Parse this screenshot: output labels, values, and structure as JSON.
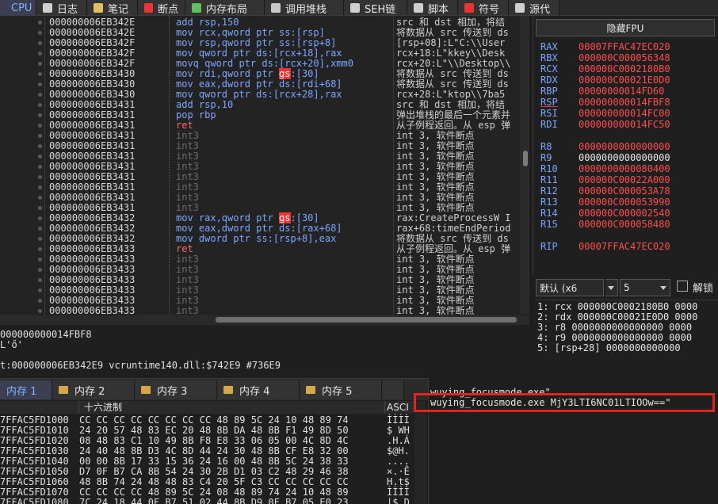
{
  "tabs": [
    {
      "label": "CPU",
      "icon": "cpu-icon",
      "color": "#5b9bff"
    },
    {
      "label": "日志",
      "icon": "log-icon",
      "color": "#cfcfcf"
    },
    {
      "label": "笔记",
      "icon": "notes-icon",
      "color": "#e0c060"
    },
    {
      "label": "断点",
      "icon": "breakpoint-icon",
      "color": "#e33"
    },
    {
      "label": "内存布局",
      "icon": "memory-map-icon",
      "color": "#5fbf5f"
    },
    {
      "label": "调用堆栈",
      "icon": "call-stack-icon",
      "color": "#c8c8c8"
    },
    {
      "label": "SEH链",
      "icon": "seh-icon",
      "color": "#cfcfcf"
    },
    {
      "label": "脚本",
      "icon": "script-icon",
      "color": "#cfcfcf"
    },
    {
      "label": "符号",
      "icon": "symbols-icon",
      "color": "#e33"
    },
    {
      "label": "源代",
      "icon": "source-icon",
      "color": "#cfcfcf"
    }
  ],
  "disasm": [
    {
      "addr": "000000006EB342E",
      "ins": "add rsp,150",
      "cmt": "src 和 dst 相加，将结"
    },
    {
      "addr": "000000006EB342E",
      "ins": "mov rcx,qword ptr ss:[rsp]",
      "cmt": "将数据从 src 传送到 ds"
    },
    {
      "addr": "000000006EB342F",
      "ins": "mov rsp,qword ptr ss:[rsp+8]",
      "cmt": "[rsp+08]:L\"C:\\\\User"
    },
    {
      "addr": "000000006EB342F",
      "ins": "mov qword ptr ds:[rcx+18],rax",
      "cmt": "rcx+18:L\"kkey\\\\Desk"
    },
    {
      "addr": "000000006EB342F",
      "ins": "movq qword ptr ds:[rcx+20],xmm0",
      "cmt": "rcx+20:L\"\\\\Desktop\\\\"
    },
    {
      "addr": "000000006EB3430",
      "ins_pre": "mov rdi,qword ptr ",
      "ins_hl": "gs",
      "ins_post": ":[30]",
      "cmt": "将数据从 src 传送到 ds"
    },
    {
      "addr": "000000006EB3430",
      "ins": "mov eax,dword ptr ds:[rdi+68]",
      "cmt": "将数据从 src 传送到 ds"
    },
    {
      "addr": "000000006EB3430",
      "ins": "mov qword ptr ds:[rcx+28],rax",
      "cmt": "rcx+28:L\"ktop\\\\7ba5"
    },
    {
      "addr": "000000006EB3431",
      "ins": "add rsp,10",
      "cmt": "src 和 dst 相加，将结"
    },
    {
      "addr": "000000006EB3431",
      "ins": "pop rbp",
      "cmt": "弹出堆栈的最后一个元素并"
    },
    {
      "addr": "000000006EB3431",
      "ins": "ret",
      "type": "ret",
      "cmt": "从子例程返回。从 esp 弹"
    },
    {
      "addr": "000000006EB3431",
      "ins": "int3",
      "type": "int",
      "cmt": "int 3, 软件断点"
    },
    {
      "addr": "000000006EB3431",
      "ins": "int3",
      "type": "int",
      "cmt": "int 3, 软件断点"
    },
    {
      "addr": "000000006EB3431",
      "ins": "int3",
      "type": "int",
      "cmt": "int 3, 软件断点"
    },
    {
      "addr": "000000006EB3431",
      "ins": "int3",
      "type": "int",
      "cmt": "int 3, 软件断点"
    },
    {
      "addr": "000000006EB3431",
      "ins": "int3",
      "type": "int",
      "cmt": "int 3, 软件断点"
    },
    {
      "addr": "000000006EB3431",
      "ins": "int3",
      "type": "int",
      "cmt": "int 3, 软件断点"
    },
    {
      "addr": "000000006EB3431",
      "ins": "int3",
      "type": "int",
      "cmt": "int 3, 软件断点"
    },
    {
      "addr": "000000006EB3431",
      "ins": "int3",
      "type": "int",
      "cmt": "int 3, 软件断点"
    },
    {
      "addr": "000000006EB3432",
      "ins_pre": "mov rax,qword ptr ",
      "ins_hl": "gs",
      "ins_post": ":[30]",
      "cmt": "rax:CreateProcessW I"
    },
    {
      "addr": "000000006EB3432",
      "ins": "mov eax,dword ptr ds:[rax+68]",
      "cmt": "rax+68:timeEndPeriod"
    },
    {
      "addr": "000000006EB3432",
      "ins": "mov dword ptr ss:[rsp+8],eax",
      "cmt": "将数据从 src 传送到 ds"
    },
    {
      "addr": "000000006EB3433",
      "ins": "ret",
      "type": "ret",
      "cmt": "从子例程返回。从 esp 弹"
    },
    {
      "addr": "000000006EB3433",
      "ins": "int3",
      "type": "int",
      "cmt": "int 3, 软件断点"
    },
    {
      "addr": "000000006EB3433",
      "ins": "int3",
      "type": "int",
      "cmt": "int 3, 软件断点"
    },
    {
      "addr": "000000006EB3433",
      "ins": "int3",
      "type": "int",
      "cmt": "int 3, 软件断点"
    },
    {
      "addr": "000000006EB3433",
      "ins": "int3",
      "type": "int",
      "cmt": "int 3, 软件断点"
    },
    {
      "addr": "000000006EB3433",
      "ins": "int3",
      "type": "int",
      "cmt": "int 3, 软件断点"
    },
    {
      "addr": "000000006EB3433",
      "ins": "int3",
      "type": "int",
      "cmt": "int 3, 软件断点"
    }
  ],
  "info": {
    "line1": "000000000014FBF8",
    "line2": "L'ő'",
    "line3": "t:000000006EB342E9 vcruntime140.dll:$742E9 #736E9"
  },
  "registers": {
    "fpu_button": "隐藏FPU",
    "group1": [
      {
        "name": "RAX",
        "value": "00007FFAC47EC020",
        "red": true
      },
      {
        "name": "RBX",
        "value": "000000C000056348",
        "red": true
      },
      {
        "name": "RCX",
        "value": "000000C0002180B0",
        "red": true
      },
      {
        "name": "RDX",
        "value": "000000C00021E0D0",
        "red": true
      },
      {
        "name": "RBP",
        "value": "00000000014FD60",
        "red": true
      },
      {
        "name": "RSP",
        "value": "000000000014FBF8",
        "red": true,
        "underline": true
      },
      {
        "name": "RSI",
        "value": "000000000014FC00",
        "red": true
      },
      {
        "name": "RDI",
        "value": "000000000014FC50",
        "red": true
      }
    ],
    "group2": [
      {
        "name": "R8",
        "value": "0000000000000000",
        "red": true
      },
      {
        "name": "R9",
        "value": "0000000000000000",
        "red": false
      },
      {
        "name": "R10",
        "value": "0000000000080400",
        "red": true
      },
      {
        "name": "R11",
        "value": "000000C00022A000",
        "red": true
      },
      {
        "name": "R12",
        "value": "000000C000053A78",
        "red": true
      },
      {
        "name": "R13",
        "value": "000000C000053990",
        "red": true
      },
      {
        "name": "R14",
        "value": "000000C000002540",
        "red": true
      },
      {
        "name": "R15",
        "value": "000000C000058480",
        "red": true
      }
    ],
    "rip": {
      "name": "RIP",
      "value": "00007FFAC47EC020"
    }
  },
  "stack_ctl": {
    "convention": "默认 (x6",
    "count": "5",
    "unlock_label": "解锁"
  },
  "stack_args": [
    "1: rcx 000000C0002180B0 0000",
    "2: rdx 000000C00021E0D0 0000",
    "3: r8 0000000000000000 0000",
    "4: r9 0000000000000000 0000",
    "5: [rsp+28] 0000000000000"
  ],
  "lowtabs": [
    {
      "label": "内存 1"
    },
    {
      "label": "内存 2"
    },
    {
      "label": "内存 3"
    },
    {
      "label": "内存 4"
    },
    {
      "label": "内存 5"
    }
  ],
  "dump": {
    "header_addr": "",
    "header_hex": "十六进制",
    "header_ascii": "ASCI",
    "rows": [
      {
        "a": "7FFAC5FD1000",
        "x": "CC CC CC CC CC CC CC CC 48 89 5C 24 10 48 89 74",
        "c": "ÌÌÌÌ"
      },
      {
        "a": "7FFAC5FD1010",
        "x": "24 20 57 48 83 EC 20 48 8B DA 48 8B F1 49 8D 50",
        "c": "$ WH"
      },
      {
        "a": "7FFAC5FD1020",
        "x": "08 48 83 C1 10 49 8B F8 E8 33 06 05 00 4C 8D 4C",
        "c": ".H.Á"
      },
      {
        "a": "7FFAC5FD1030",
        "x": "24 40 48 8B D3 4C 8D 44 24 30 48 8B CF E8 32 00",
        "c": "$@H."
      },
      {
        "a": "7FFAC5FD1040",
        "x": "00 00 8B 17 33 15 36 24 16 00 48 8B 5C 24 38 33",
        "c": "...."
      },
      {
        "a": "7FFAC5FD1050",
        "x": "D7 0F B7 CA 8B 54 24 30 2B D1 03 C2 48 29 46 38",
        "c": "×.·Ê"
      },
      {
        "a": "7FFAC5FD1060",
        "x": "48 8B 74 24 48 48 83 C4 20 5F C3 CC CC CC CC CC",
        "c": "H.t$"
      },
      {
        "a": "7FFAC5FD1070",
        "x": "CC CC CC CC 48 89 5C 24 08 48 89 74 24 10 48 89",
        "c": "ÌÌÌÌ"
      },
      {
        "a": "7FFAC5FD1080",
        "x": "7C 24 18 44 0F B7 51 02 44 8B D9 0F B7 05 E0 23",
        "c": "|$.D"
      }
    ]
  },
  "watch": {
    "line1": "wuying_focusmode.exe\"",
    "line2": "wuying_focusmode.exe MjY3LTI6NC01LTIOOw==\""
  }
}
